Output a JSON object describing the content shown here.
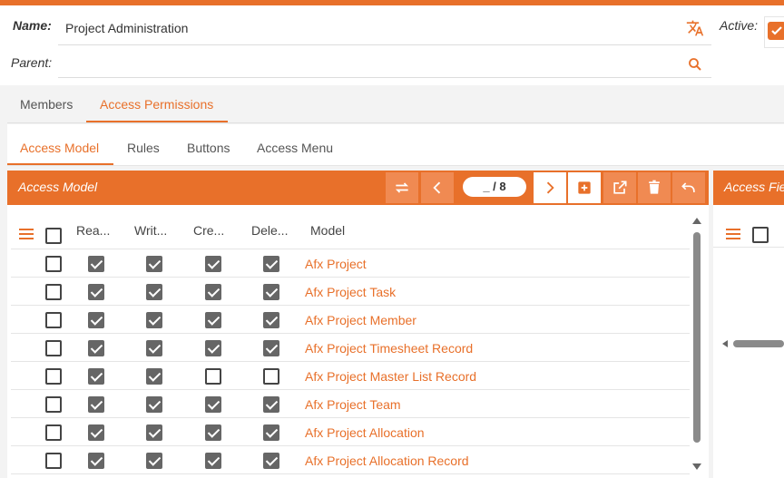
{
  "form": {
    "name_label": "Name:",
    "name_value": "Project Administration",
    "parent_label": "Parent:",
    "parent_value": "",
    "active_label": "Active:",
    "active_checked": true
  },
  "tabs_primary": [
    {
      "label": "Members",
      "active": false
    },
    {
      "label": "Access Permissions",
      "active": true
    }
  ],
  "tabs_secondary": [
    {
      "label": "Access Model",
      "active": true
    },
    {
      "label": "Rules",
      "active": false
    },
    {
      "label": "Buttons",
      "active": false
    },
    {
      "label": "Access Menu",
      "active": false
    }
  ],
  "panel": {
    "title": "Access Model",
    "pager": "_ / 8",
    "columns": [
      "Rea...",
      "Writ...",
      "Cre...",
      "Dele...",
      "Model"
    ],
    "rows": [
      {
        "select": false,
        "read": true,
        "write": true,
        "create": true,
        "delete": true,
        "model": "Afx Project"
      },
      {
        "select": false,
        "read": true,
        "write": true,
        "create": true,
        "delete": true,
        "model": "Afx Project Task"
      },
      {
        "select": false,
        "read": true,
        "write": true,
        "create": true,
        "delete": true,
        "model": "Afx Project Member"
      },
      {
        "select": false,
        "read": true,
        "write": true,
        "create": true,
        "delete": true,
        "model": "Afx Project Timesheet Record"
      },
      {
        "select": false,
        "read": true,
        "write": true,
        "create": false,
        "delete": false,
        "model": "Afx Project Master List Record"
      },
      {
        "select": false,
        "read": true,
        "write": true,
        "create": true,
        "delete": true,
        "model": "Afx Project Team"
      },
      {
        "select": false,
        "read": true,
        "write": true,
        "create": true,
        "delete": true,
        "model": "Afx Project Allocation"
      },
      {
        "select": false,
        "read": true,
        "write": true,
        "create": true,
        "delete": true,
        "model": "Afx Project Allocation Record"
      }
    ]
  },
  "panel2": {
    "title": "Access Fie"
  },
  "colors": {
    "accent": "#e8702a",
    "accent_light": "#f08a52"
  },
  "icons": {
    "translate": "translate-icon",
    "search": "search-icon",
    "swap": "swap-icon",
    "prev": "chevron-left-icon",
    "next": "chevron-right-icon",
    "add": "add-icon",
    "open": "open-external-icon",
    "delete": "trash-icon",
    "undo": "undo-icon",
    "menu": "hamburger-icon"
  }
}
